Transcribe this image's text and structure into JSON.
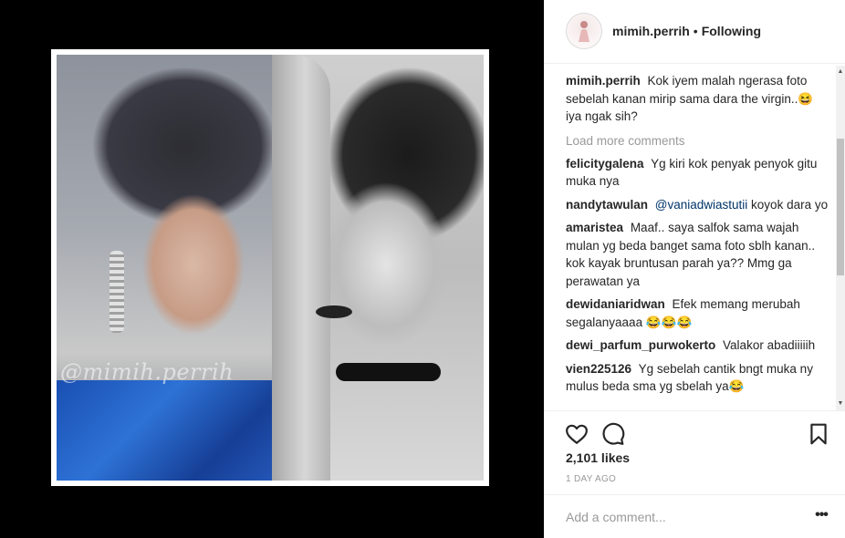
{
  "post": {
    "watermark": "@mimih.perrih"
  },
  "header": {
    "username": "mimih.perrih",
    "separator": "•",
    "follow_status": "Following"
  },
  "comments": {
    "caption": {
      "user": "mimih.perrih",
      "text": "Kok iyem malah ngerasa foto sebelah kanan mirip sama dara the virgin..😆 iya ngak sih?"
    },
    "load_more": "Load more comments",
    "items": [
      {
        "user": "felicitygalena",
        "text": "Yg kiri kok penyak penyok gitu muka nya"
      },
      {
        "user": "nandytawulan",
        "mention": "@vaniadwiastutii",
        "text": " koyok dara yo"
      },
      {
        "user": "amaristea",
        "text": "Maaf.. saya salfok sama wajah mulan yg beda banget sama foto sblh kanan.. kok kayak bruntusan parah ya?? Mmg ga perawatan ya"
      },
      {
        "user": "dewidaniaridwan",
        "text": "Efek memang merubah segalanyaaaa 😂😂😂"
      },
      {
        "user": "dewi_parfum_purwokerto",
        "text": "Valakor abadiiiiih"
      },
      {
        "user": "vien225126",
        "text": "Yg sebelah cantik bngt muka ny mulus beda sma yg sbelah ya😂"
      }
    ]
  },
  "actions": {
    "like_icon": "heart-icon",
    "comment_icon": "comment-icon",
    "save_icon": "bookmark-icon"
  },
  "likes": "2,101 likes",
  "timestamp": "1 DAY AGO",
  "add_comment": {
    "placeholder": "Add a comment...",
    "more_label": "•••"
  }
}
